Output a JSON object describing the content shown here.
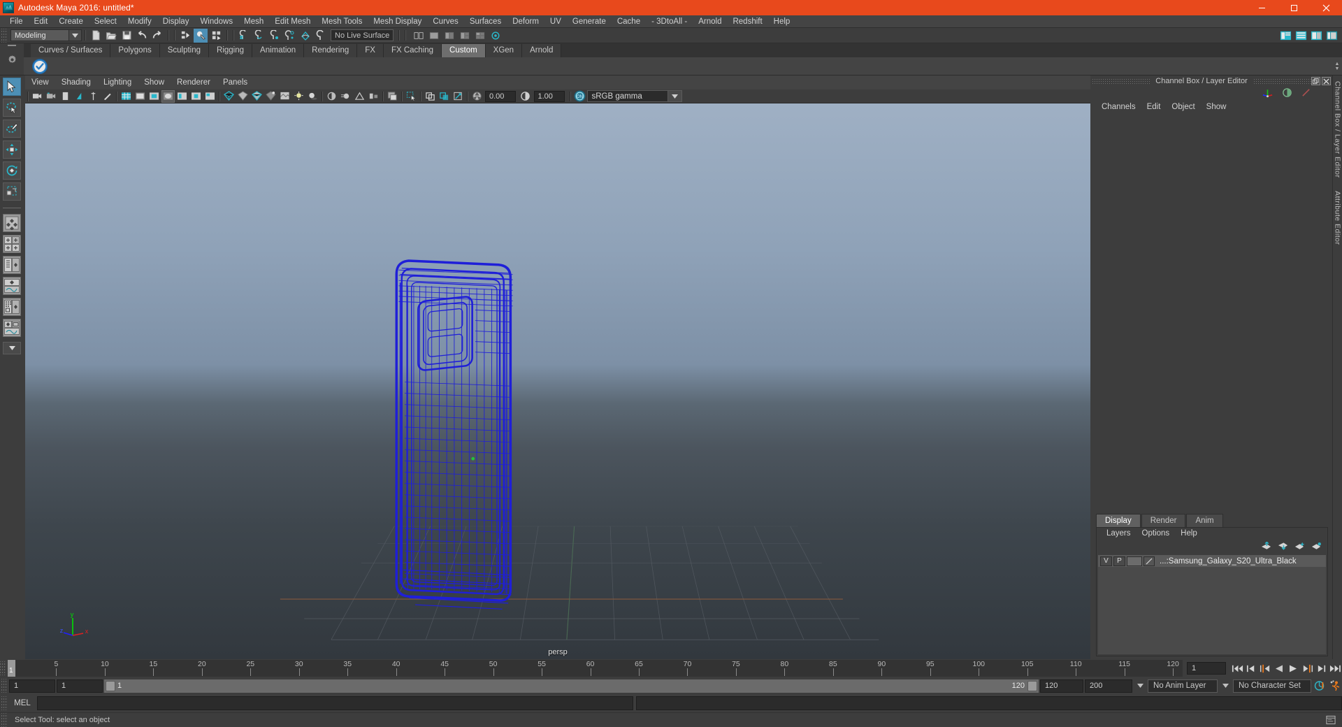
{
  "window": {
    "title": "Autodesk Maya 2016: untitled*",
    "minimize": "–",
    "maximize": "□",
    "close": "✕",
    "accent": "#e8491c"
  },
  "menubar": {
    "items": [
      {
        "label": "File"
      },
      {
        "label": "Edit"
      },
      {
        "label": "Create"
      },
      {
        "label": "Select"
      },
      {
        "label": "Modify"
      },
      {
        "label": "Display"
      },
      {
        "label": "Windows"
      },
      {
        "label": "Mesh"
      },
      {
        "label": "Edit Mesh"
      },
      {
        "label": "Mesh Tools"
      },
      {
        "label": "Mesh Display"
      },
      {
        "label": "Curves"
      },
      {
        "label": "Surfaces"
      },
      {
        "label": "Deform"
      },
      {
        "label": "UV"
      },
      {
        "label": "Generate"
      },
      {
        "label": "Cache"
      },
      {
        "label": "- 3DtoAll -"
      },
      {
        "label": "Arnold"
      },
      {
        "label": "Redshift"
      },
      {
        "label": "Help"
      }
    ]
  },
  "toolbar": {
    "menuset": "Modeling",
    "live_surface": "No Live Surface"
  },
  "shelf": {
    "tabs": [
      {
        "label": "Curves / Surfaces",
        "active": false
      },
      {
        "label": "Polygons",
        "active": false
      },
      {
        "label": "Sculpting",
        "active": false
      },
      {
        "label": "Rigging",
        "active": false
      },
      {
        "label": "Animation",
        "active": false
      },
      {
        "label": "Rendering",
        "active": false
      },
      {
        "label": "FX",
        "active": false
      },
      {
        "label": "FX Caching",
        "active": false
      },
      {
        "label": "Custom",
        "active": true
      },
      {
        "label": "XGen",
        "active": false
      },
      {
        "label": "Arnold",
        "active": false
      }
    ]
  },
  "viewport": {
    "menus": [
      {
        "label": "View"
      },
      {
        "label": "Shading"
      },
      {
        "label": "Lighting"
      },
      {
        "label": "Show"
      },
      {
        "label": "Renderer"
      },
      {
        "label": "Panels"
      }
    ],
    "exposure": "0.00",
    "gamma_value": "1.00",
    "color_management": "sRGB gamma",
    "camera_label": "persp",
    "axis": {
      "x": "x",
      "y": "y",
      "z": "z"
    },
    "wireframe_color": "#1a1ad2",
    "model_name": "Samsung Galaxy S20 Ultra"
  },
  "right_panel": {
    "title": "Channel Box / Layer Editor",
    "menus": [
      {
        "label": "Channels"
      },
      {
        "label": "Edit"
      },
      {
        "label": "Object"
      },
      {
        "label": "Show"
      }
    ],
    "tabs": [
      {
        "label": "Display",
        "active": true
      },
      {
        "label": "Render",
        "active": false
      },
      {
        "label": "Anim",
        "active": false
      }
    ],
    "layer_menus": [
      {
        "label": "Layers"
      },
      {
        "label": "Options"
      },
      {
        "label": "Help"
      }
    ],
    "layers": [
      {
        "visible": "V",
        "playback": "P",
        "name": "...:Samsung_Galaxy_S20_Ultra_Black"
      }
    ],
    "docked_tabs": [
      "Channel Box / Layer Editor",
      "Attribute Editor"
    ]
  },
  "timeline": {
    "ticks": [
      5,
      10,
      15,
      20,
      25,
      30,
      35,
      40,
      45,
      50,
      55,
      60,
      65,
      70,
      75,
      80,
      85,
      90,
      95,
      100,
      105,
      110,
      115,
      120
    ],
    "current_frame": "1",
    "current_frame_field": "1",
    "range_start": "1",
    "range_end": "1",
    "anim_start": "120",
    "anim_end": "200",
    "range_slider_left_label": "1",
    "range_slider_right_label": "120",
    "anim_layer": "No Anim Layer",
    "character_set": "No Character Set"
  },
  "command": {
    "mel_label": "MEL",
    "input_value": "",
    "result_value": ""
  },
  "status": {
    "text": "Select Tool: select an object"
  }
}
